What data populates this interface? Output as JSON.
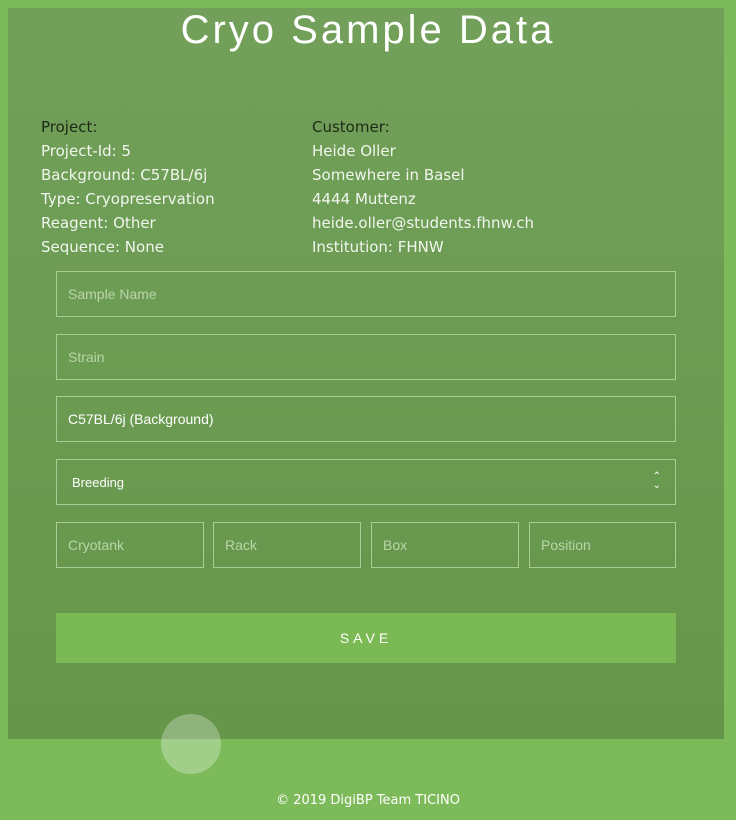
{
  "title": "Cryo Sample Data",
  "project": {
    "heading": "Project:",
    "lines": [
      "Project-Id: 5",
      "Background: C57BL/6j",
      "Type: Cryopreservation",
      "Reagent: Other",
      "Sequence: None"
    ]
  },
  "customer": {
    "heading": "Customer:",
    "lines": [
      "Heide Oller",
      "Somewhere in Basel",
      "4444 Muttenz",
      "heide.oller@students.fhnw.ch",
      "Institution: FHNW"
    ]
  },
  "form": {
    "sample_name_placeholder": "Sample Name",
    "strain_placeholder": "Strain",
    "background_value": "C57BL/6j (Background)",
    "breeding_selected": "Breeding",
    "cryotank_placeholder": "Cryotank",
    "rack_placeholder": "Rack",
    "box_placeholder": "Box",
    "position_placeholder": "Position",
    "save_label": "SAVE"
  },
  "footer": "© 2019 DigiBP Team TICINO"
}
